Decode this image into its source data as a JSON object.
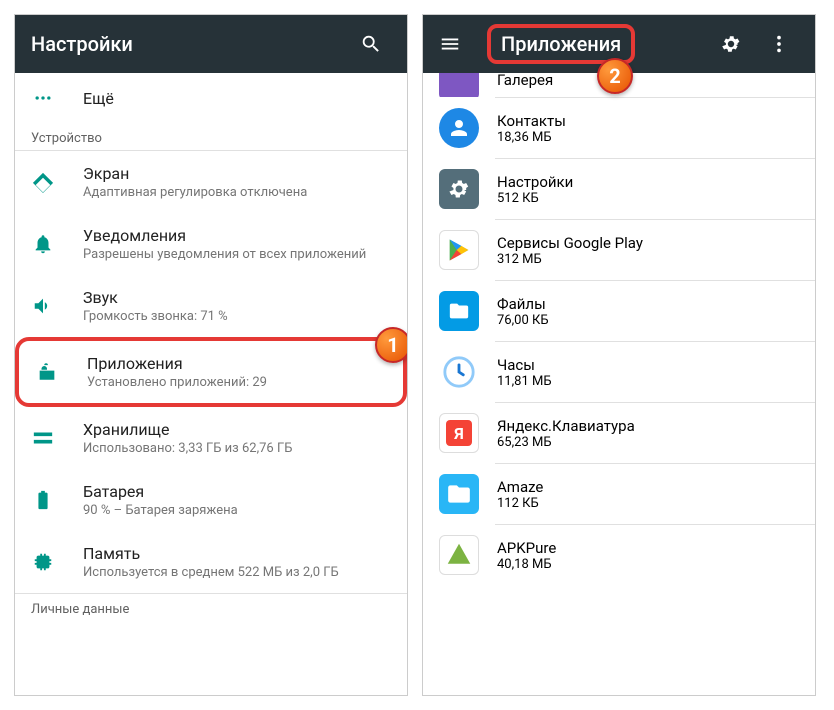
{
  "left": {
    "title": "Настройки",
    "more_label": "Ещё",
    "section_device": "Устройство",
    "section_personal": "Личные данные",
    "items": [
      {
        "icon": "display",
        "title": "Экран",
        "sub": "Адаптивная регулировка отключена"
      },
      {
        "icon": "bell",
        "title": "Уведомления",
        "sub": "Разрешены уведомления от всех приложений"
      },
      {
        "icon": "sound",
        "title": "Звук",
        "sub": "Громкость звонка: 71 %"
      },
      {
        "icon": "apps",
        "title": "Приложения",
        "sub": "Установлено приложений: 29",
        "highlight": true
      },
      {
        "icon": "storage",
        "title": "Хранилище",
        "sub": "Использовано: 3,33 ГБ из 62,76 ГБ"
      },
      {
        "icon": "battery",
        "title": "Батарея",
        "sub": "90 % – Батарея заряжена"
      },
      {
        "icon": "memory",
        "title": "Память",
        "sub": "Используется в среднем 522 МБ из 2,0 ГБ"
      }
    ],
    "badge": "1"
  },
  "right": {
    "title": "Приложения",
    "badge": "2",
    "apps": [
      {
        "name": "Галерея",
        "size": "",
        "color": "#7e57c2",
        "partial": true
      },
      {
        "name": "Контакты",
        "size": "18,36 МБ",
        "color": "#1e88e5",
        "glyph": "person"
      },
      {
        "name": "Настройки",
        "size": "512 КБ",
        "color": "#546e7a",
        "glyph": "gear"
      },
      {
        "name": "Сервисы Google Play",
        "size": "312 МБ",
        "color": "#ffffff",
        "glyph": "play"
      },
      {
        "name": "Файлы",
        "size": "76,00 КБ",
        "color": "#039be5",
        "glyph": "folder"
      },
      {
        "name": "Часы",
        "size": "11,81 МБ",
        "color": "#e3f2fd",
        "glyph": "clock"
      },
      {
        "name": "Яндекс.Клавиатура",
        "size": "65,23 МБ",
        "color": "#ffffff",
        "glyph": "ya"
      },
      {
        "name": "Amaze",
        "size": "112 КБ",
        "color": "#29b6f6",
        "glyph": "folder2"
      },
      {
        "name": "APKPure",
        "size": "40,18 МБ",
        "color": "#ffffff",
        "glyph": "apk"
      }
    ]
  }
}
